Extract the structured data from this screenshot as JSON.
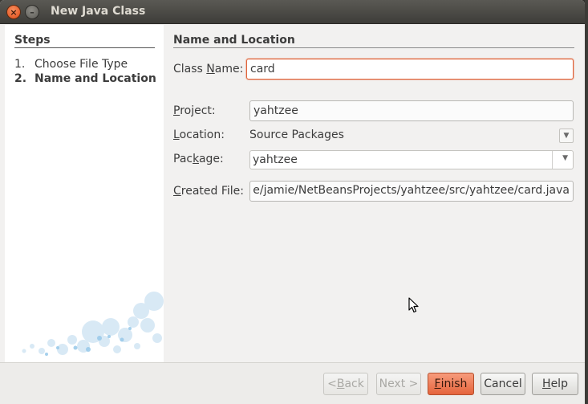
{
  "window": {
    "title": "New Java Class",
    "close_glyph": "×",
    "minimize_glyph": "–"
  },
  "steps": {
    "heading": "Steps",
    "items": [
      {
        "num": "1.",
        "label": "Choose File Type"
      },
      {
        "num": "2.",
        "label": "Name and Location"
      }
    ]
  },
  "section": {
    "heading": "Name and Location"
  },
  "form": {
    "class_name": {
      "label_pre": "Class ",
      "label_ul": "N",
      "label_post": "ame:",
      "value": "card"
    },
    "project": {
      "label_pre": "",
      "label_ul": "P",
      "label_post": "roject:",
      "value": "yahtzee"
    },
    "location": {
      "label_pre": "",
      "label_ul": "L",
      "label_post": "ocation:",
      "value": "Source Packages"
    },
    "package": {
      "label_pre": "Pac",
      "label_ul": "k",
      "label_post": "age:",
      "value": "yahtzee"
    },
    "created_file": {
      "label_pre": "",
      "label_ul": "C",
      "label_post": "reated File:",
      "value": "e/jamie/NetBeansProjects/yahtzee/src/yahtzee/card.java"
    }
  },
  "buttons": {
    "back": {
      "pre": "< ",
      "ul": "B",
      "post": "ack"
    },
    "next": "Next >",
    "finish": {
      "pre": "",
      "ul": "F",
      "post": "inish"
    },
    "cancel": "Cancel",
    "help": {
      "pre": "",
      "ul": "H",
      "post": "elp"
    }
  },
  "colors": {
    "accent": "#e5643c",
    "titlebar": "#3e3d39",
    "panel": "#f2f1f0"
  },
  "icons": {
    "dropdown": "chevron-down-icon",
    "cursor": "mouse-pointer-icon"
  }
}
